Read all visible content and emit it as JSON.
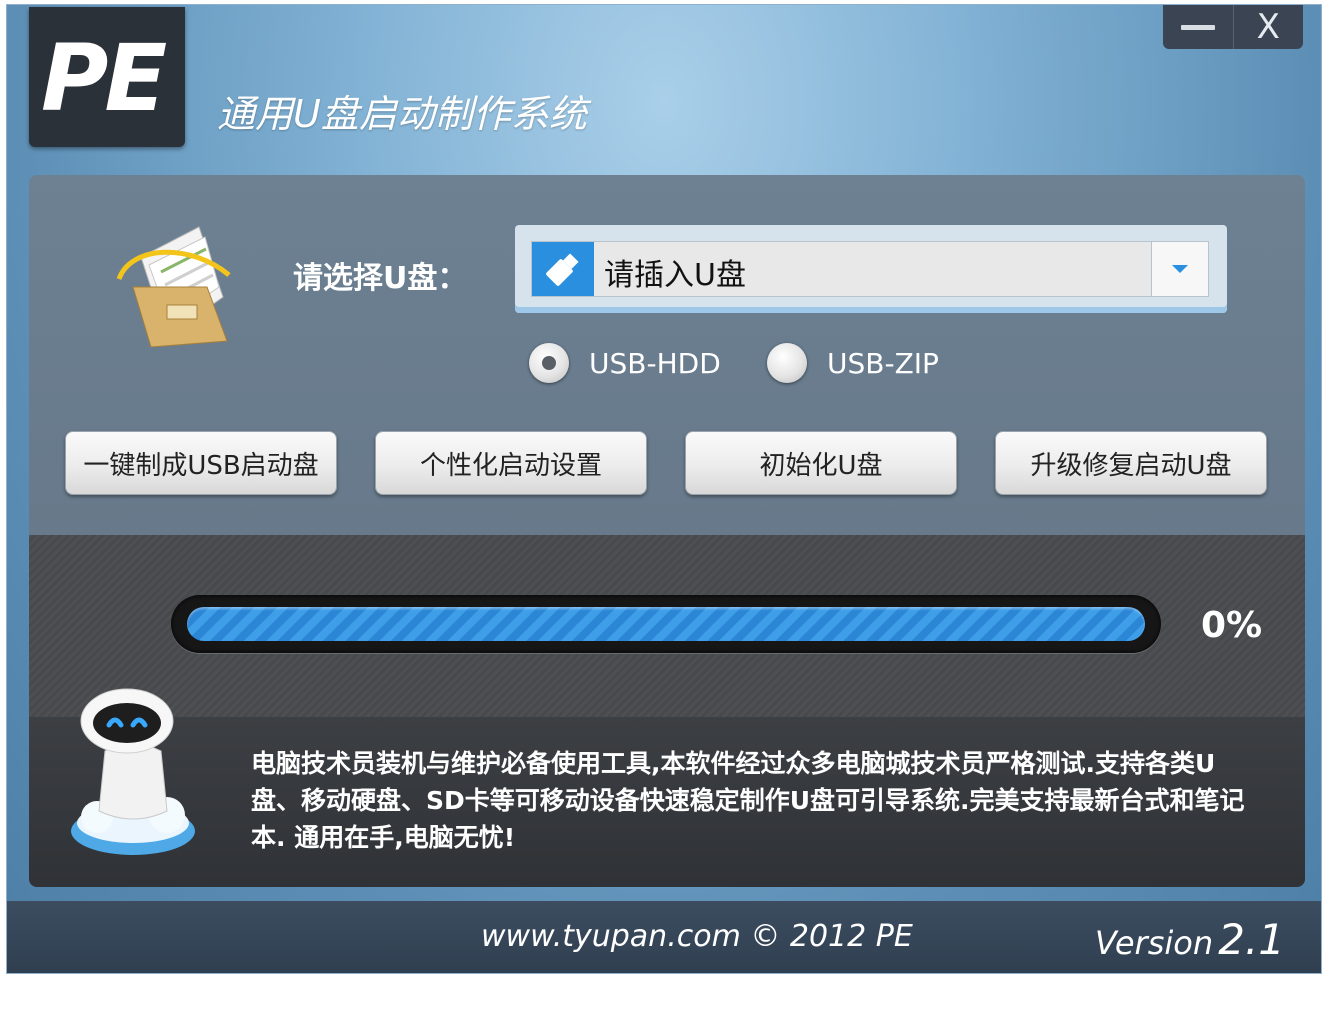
{
  "window": {
    "logo": "PE",
    "title": "通用U盘启动制作系统",
    "controls": {
      "minimize_icon": "minimize-icon",
      "close_icon": "close-icon",
      "close_glyph": "X"
    }
  },
  "usb_select": {
    "label": "请选择U盘：",
    "value": "请插入U盘",
    "icon": "usb-drive-icon"
  },
  "mode": {
    "options": [
      {
        "label": "USB-HDD",
        "selected": true
      },
      {
        "label": "USB-ZIP",
        "selected": false
      }
    ]
  },
  "buttons": [
    {
      "label": "一键制成USB启动盘"
    },
    {
      "label": "个性化启动设置"
    },
    {
      "label": "初始化U盘"
    },
    {
      "label": "升级修复启动U盘"
    }
  ],
  "progress": {
    "percent_text": "0%",
    "fill_fraction": 1.0
  },
  "description": "电脑技术员装机与维护必备使用工具,本软件经过众多电脑城技术员严格测试.支持各类U盘、移动硬盘、SD卡等可移动设备快速稳定制作U盘可引导系统.完美支持最新台式和笔记本. 通用在手,电脑无忧!",
  "footer": {
    "copyright": "www.tyupan.com  © 2012 PE",
    "version_word": "Version",
    "version_number": "2.1"
  },
  "colors": {
    "accent": "#2a8fde",
    "progress": "#3e9ee8",
    "panel": "#67798a",
    "footer": "#34455a"
  }
}
